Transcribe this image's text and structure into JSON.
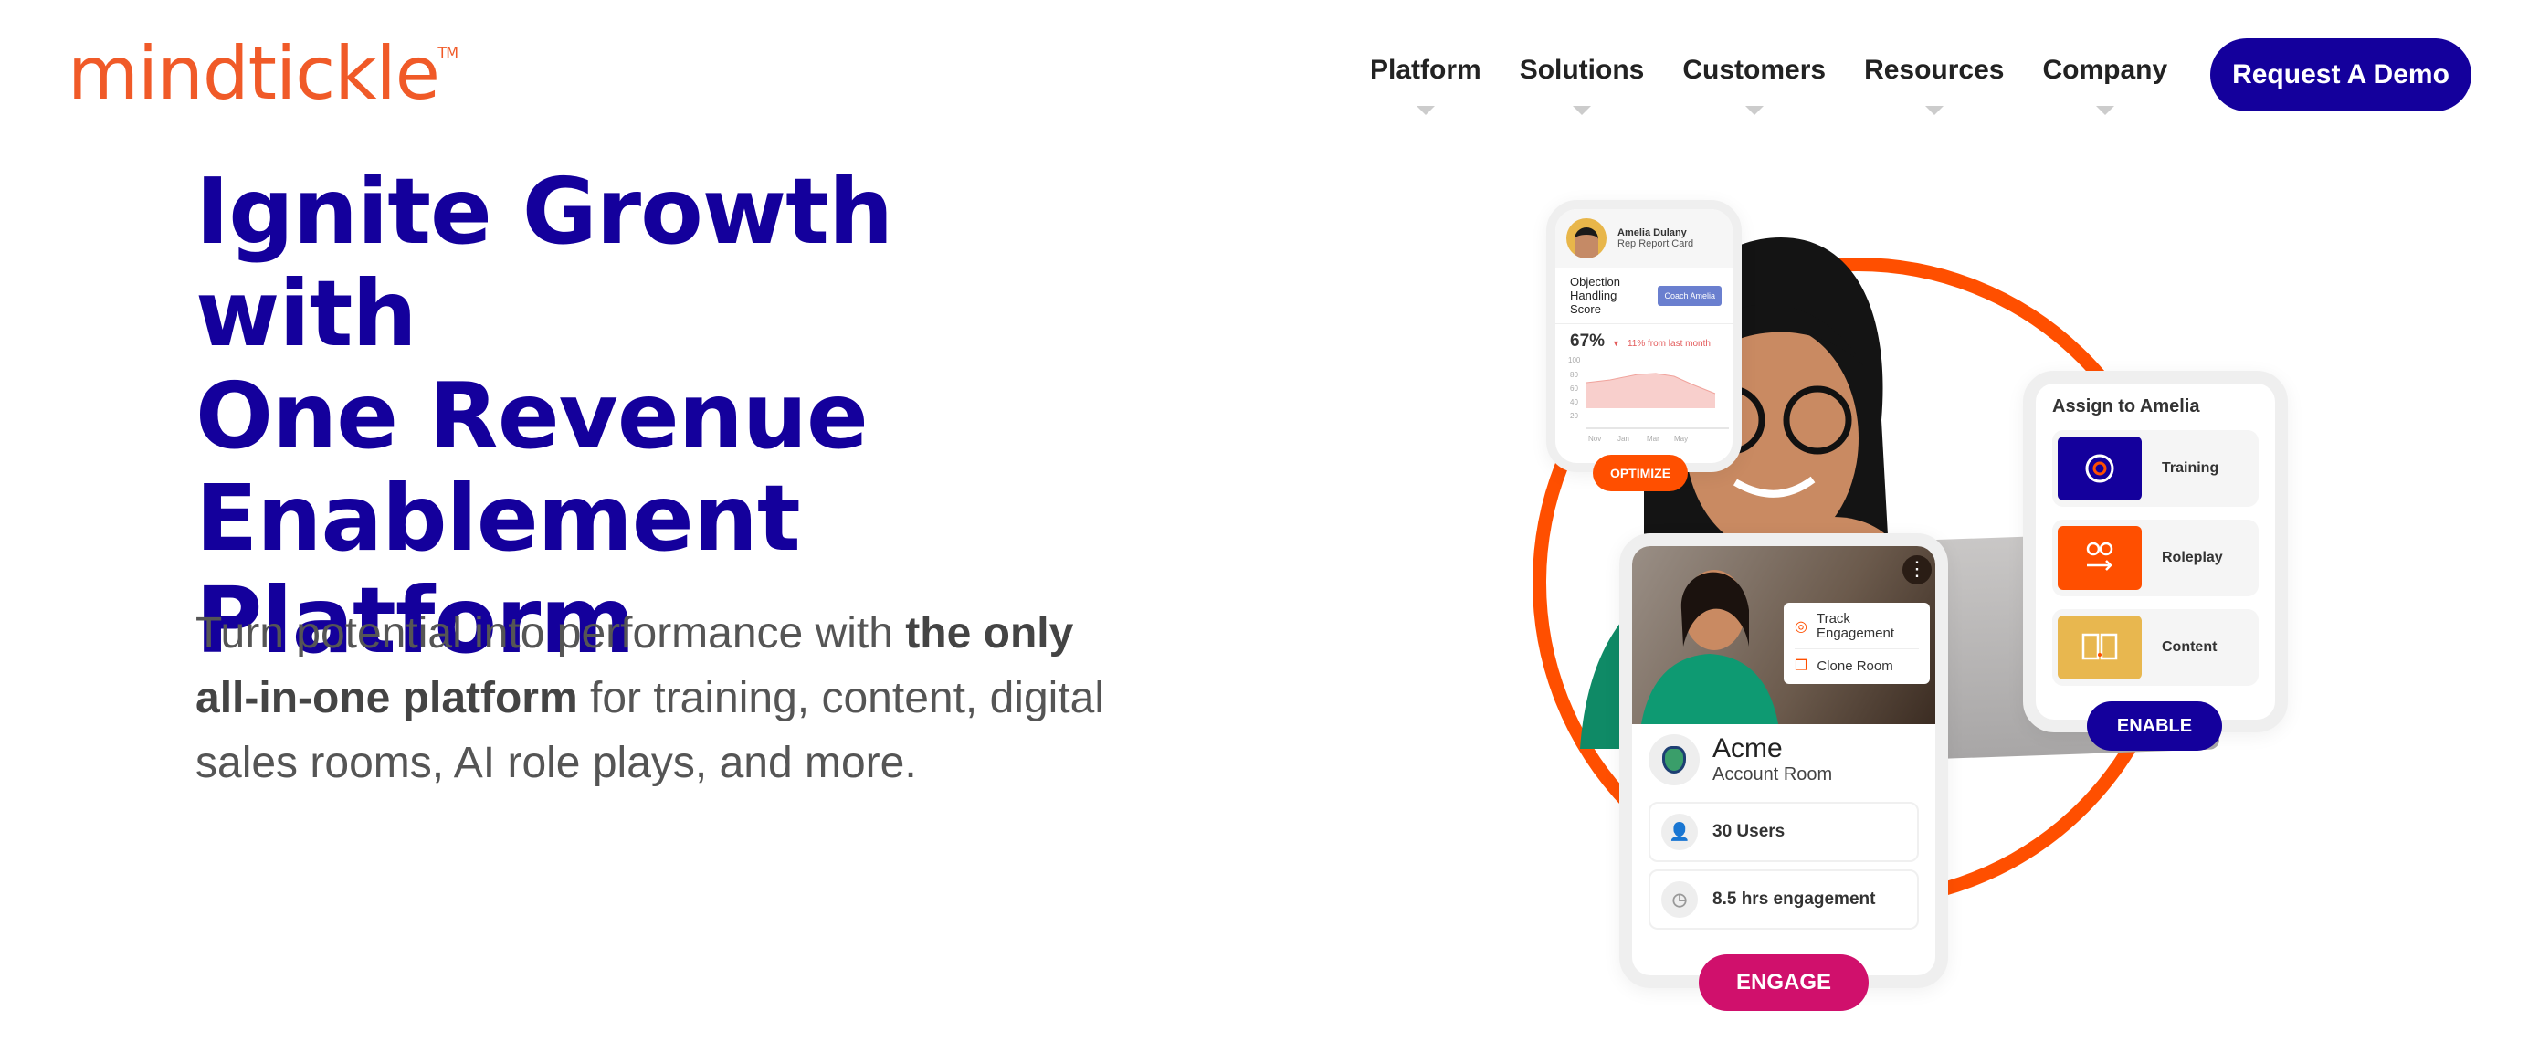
{
  "brand": {
    "logo": "mindtickle",
    "tm": "TM",
    "color": "#f05a28"
  },
  "nav": {
    "items": [
      "Platform",
      "Solutions",
      "Customers",
      "Resources",
      "Company"
    ],
    "cta": "Request A Demo",
    "cta_color": "#14009c"
  },
  "hero": {
    "headline": [
      "Ignite Growth with",
      "One Revenue",
      "Enablement",
      "Platform"
    ],
    "sub_pre": "Turn potential into performance with ",
    "sub_bold": "the only all-in-one platform",
    "sub_post": " for training, content, digital sales rooms, AI role plays, and more."
  },
  "report_card": {
    "name": "Amelia Dulany",
    "role": "Rep Report Card",
    "metric": "Objection Handling Score",
    "button": "Coach Amelia",
    "score": "67%",
    "change": "11% from last month",
    "y_ticks": [
      "100",
      "80",
      "60",
      "40",
      "20"
    ],
    "x_ticks": [
      "Nov",
      "Jan",
      "Mar",
      "May"
    ],
    "action": "OPTIMIZE"
  },
  "assign": {
    "title": "Assign to Amelia",
    "items": [
      "Training",
      "Roleplay",
      "Content"
    ],
    "action": "ENABLE"
  },
  "room": {
    "menu": [
      "Track Engagement",
      "Clone Room"
    ],
    "name": "Acme",
    "type": "Account Room",
    "users": "30 Users",
    "engagement": "8.5 hrs engagement",
    "action": "ENGAGE"
  },
  "colors": {
    "ring": "#ff4f00",
    "optimize": "#ff4f00",
    "enable": "#14009c",
    "engage": "#d0106c"
  }
}
